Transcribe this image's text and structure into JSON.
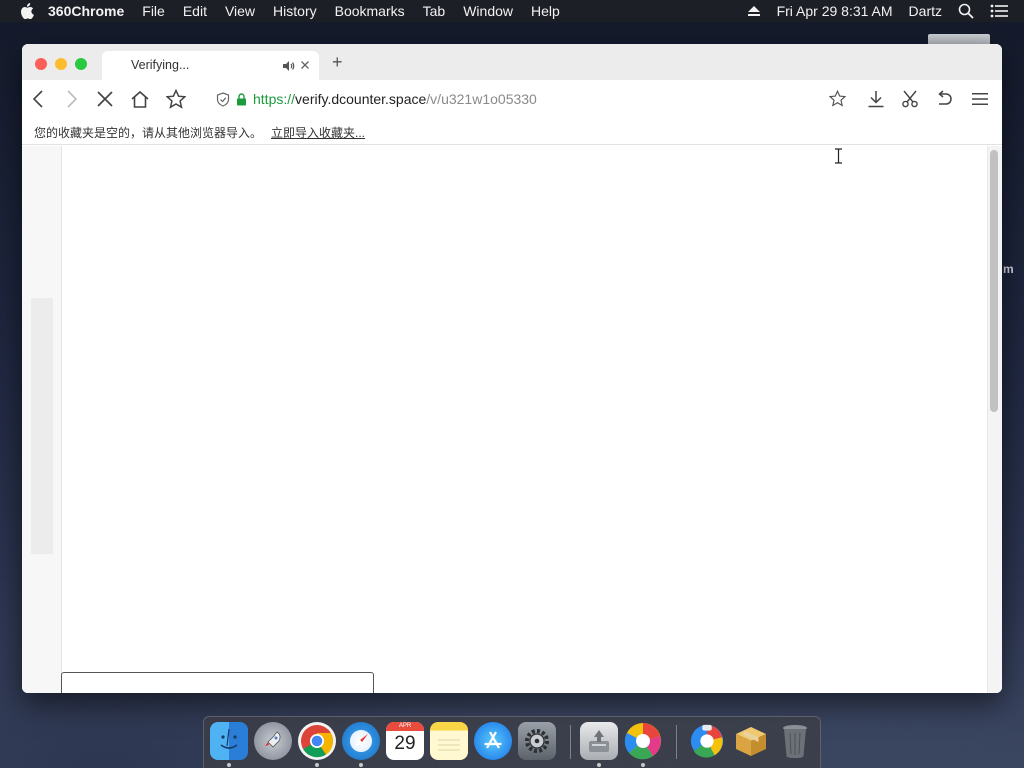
{
  "menubar": {
    "app_name": "360Chrome",
    "menus": [
      "File",
      "Edit",
      "View",
      "History",
      "Bookmarks",
      "Tab",
      "Window",
      "Help"
    ],
    "clock": "Fri Apr 29  8:31 AM",
    "user": "Dartz"
  },
  "browser": {
    "tab_title": "Verifying...",
    "new_tab_label": "+",
    "url": {
      "scheme": "https://",
      "host": "verify.dcounter.space",
      "path": "/v/u321w1o05330"
    },
    "loading": true
  },
  "bookmarks_bar": {
    "message": "您的收藏夹是空的，请从其他浏览器导入。",
    "import_link": "立即导入收藏夹..."
  },
  "desktop": {
    "side_letter": "m"
  },
  "dock": {
    "calendar_month": "APR",
    "calendar_day": "29",
    "items": [
      {
        "name": "finder",
        "running": true
      },
      {
        "name": "launchpad",
        "running": false
      },
      {
        "name": "chrome",
        "running": true
      },
      {
        "name": "safari",
        "running": true
      },
      {
        "name": "calendar",
        "running": false
      },
      {
        "name": "notes",
        "running": false
      },
      {
        "name": "app-store",
        "running": false
      },
      {
        "name": "system-preferences",
        "running": false
      },
      {
        "name": "installer",
        "running": true
      },
      {
        "name": "360chrome",
        "running": true
      },
      {
        "name": "360-browser",
        "running": false
      },
      {
        "name": "package",
        "running": false
      },
      {
        "name": "trash",
        "running": false
      }
    ]
  },
  "colors": {
    "secure_green": "#1a9b3c",
    "close_red": "#fc5f57",
    "minimize_yellow": "#fdbc2e",
    "maximize_green": "#29c940"
  }
}
